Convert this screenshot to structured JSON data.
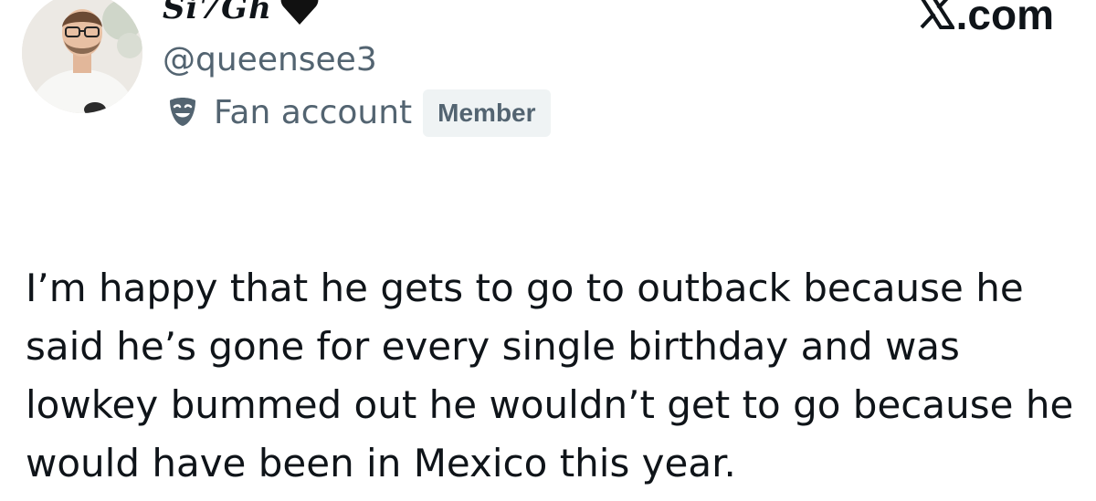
{
  "profile": {
    "display_name": "Si7Gh",
    "name_emoji_icon": "black-heart-icon",
    "handle": "@queensee3",
    "account_label": "Fan account",
    "account_label_icon": "theater-mask-icon",
    "badge": "Member"
  },
  "watermark": {
    "text": ".com",
    "logo_icon": "x-logo-icon"
  },
  "tweet": {
    "text": "I’m happy that he gets to go to outback because he said he’s gone for every single birthday and was lowkey bummed out he wouldn’t get to go because he would have been in Mexico this year."
  },
  "colors": {
    "text_primary": "#0f1419",
    "text_secondary": "#536471",
    "badge_bg": "#eff3f4"
  }
}
